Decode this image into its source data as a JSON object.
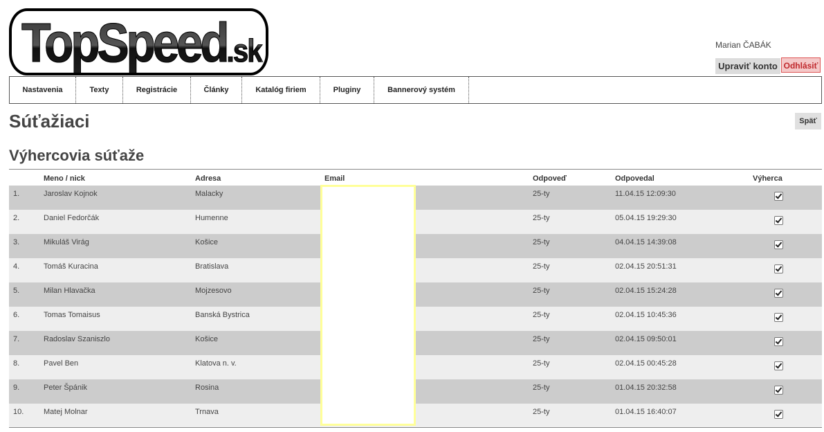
{
  "logo": {
    "text": "TopSpeed",
    "tld": ".sk"
  },
  "user": {
    "name": "Marian ČABÁK",
    "edit_account": "Upraviť konto",
    "logout": "Odhlásiť"
  },
  "nav": [
    {
      "label": "Nastavenia"
    },
    {
      "label": "Texty"
    },
    {
      "label": "Registrácie"
    },
    {
      "label": "Články"
    },
    {
      "label": "Katalóg firiem"
    },
    {
      "label": "Pluginy"
    },
    {
      "label": "Bannerový systém"
    }
  ],
  "page_title": "Súťažiaci",
  "back_label": "Späť",
  "section_title": "Výhercovia súťaže",
  "table": {
    "headers": {
      "name": "Meno / nick",
      "address": "Adresa",
      "email": "Email",
      "answer": "Odpoveď",
      "answered": "Odpovedal",
      "winner": "Výherca"
    },
    "rows": [
      {
        "num": "1.",
        "name": "Jaroslav Kojnok",
        "address": "Malacky",
        "answer": "25-ty",
        "date": "11.04.15 12:09:30",
        "winner": true
      },
      {
        "num": "2.",
        "name": "Daniel Fedorčák",
        "address": "Humenne",
        "answer": "25-ty",
        "date": "05.04.15 19:29:30",
        "winner": true
      },
      {
        "num": "3.",
        "name": "Mikuláš Virág",
        "address": "Košice",
        "answer": "25-ty",
        "date": "04.04.15 14:39:08",
        "winner": true
      },
      {
        "num": "4.",
        "name": "Tomáš Kuracina",
        "address": "Bratislava",
        "answer": "25-ty",
        "date": "02.04.15 20:51:31",
        "winner": true
      },
      {
        "num": "5.",
        "name": "Milan Hlavačka",
        "address": "Mojzesovo",
        "answer": "25-ty",
        "date": "02.04.15 15:24:28",
        "winner": true
      },
      {
        "num": "6.",
        "name": "Tomas Tomaisus",
        "address": "Banská Bystrica",
        "answer": "25-ty",
        "date": "02.04.15 10:45:36",
        "winner": true
      },
      {
        "num": "7.",
        "name": "Radoslav Szaniszlo",
        "address": "Košice",
        "answer": "25-ty",
        "date": "02.04.15 09:50:01",
        "winner": true
      },
      {
        "num": "8.",
        "name": "Pavel Ben",
        "address": "Klatova n. v.",
        "answer": "25-ty",
        "date": "02.04.15 00:45:28",
        "winner": true
      },
      {
        "num": "9.",
        "name": "Peter Špánik",
        "address": "Rosina",
        "answer": "25-ty",
        "date": "01.04.15 20:32:58",
        "winner": true
      },
      {
        "num": "10.",
        "name": "Matej Molnar",
        "address": "Trnava",
        "answer": "25-ty",
        "date": "01.04.15 16:40:07",
        "winner": true
      }
    ]
  },
  "colors": {
    "answer_green": "#33a033",
    "logout_red": "#c0282c",
    "row_dark": "#cccccc",
    "row_light": "#eeeeee",
    "mask_border": "#ffff99"
  }
}
